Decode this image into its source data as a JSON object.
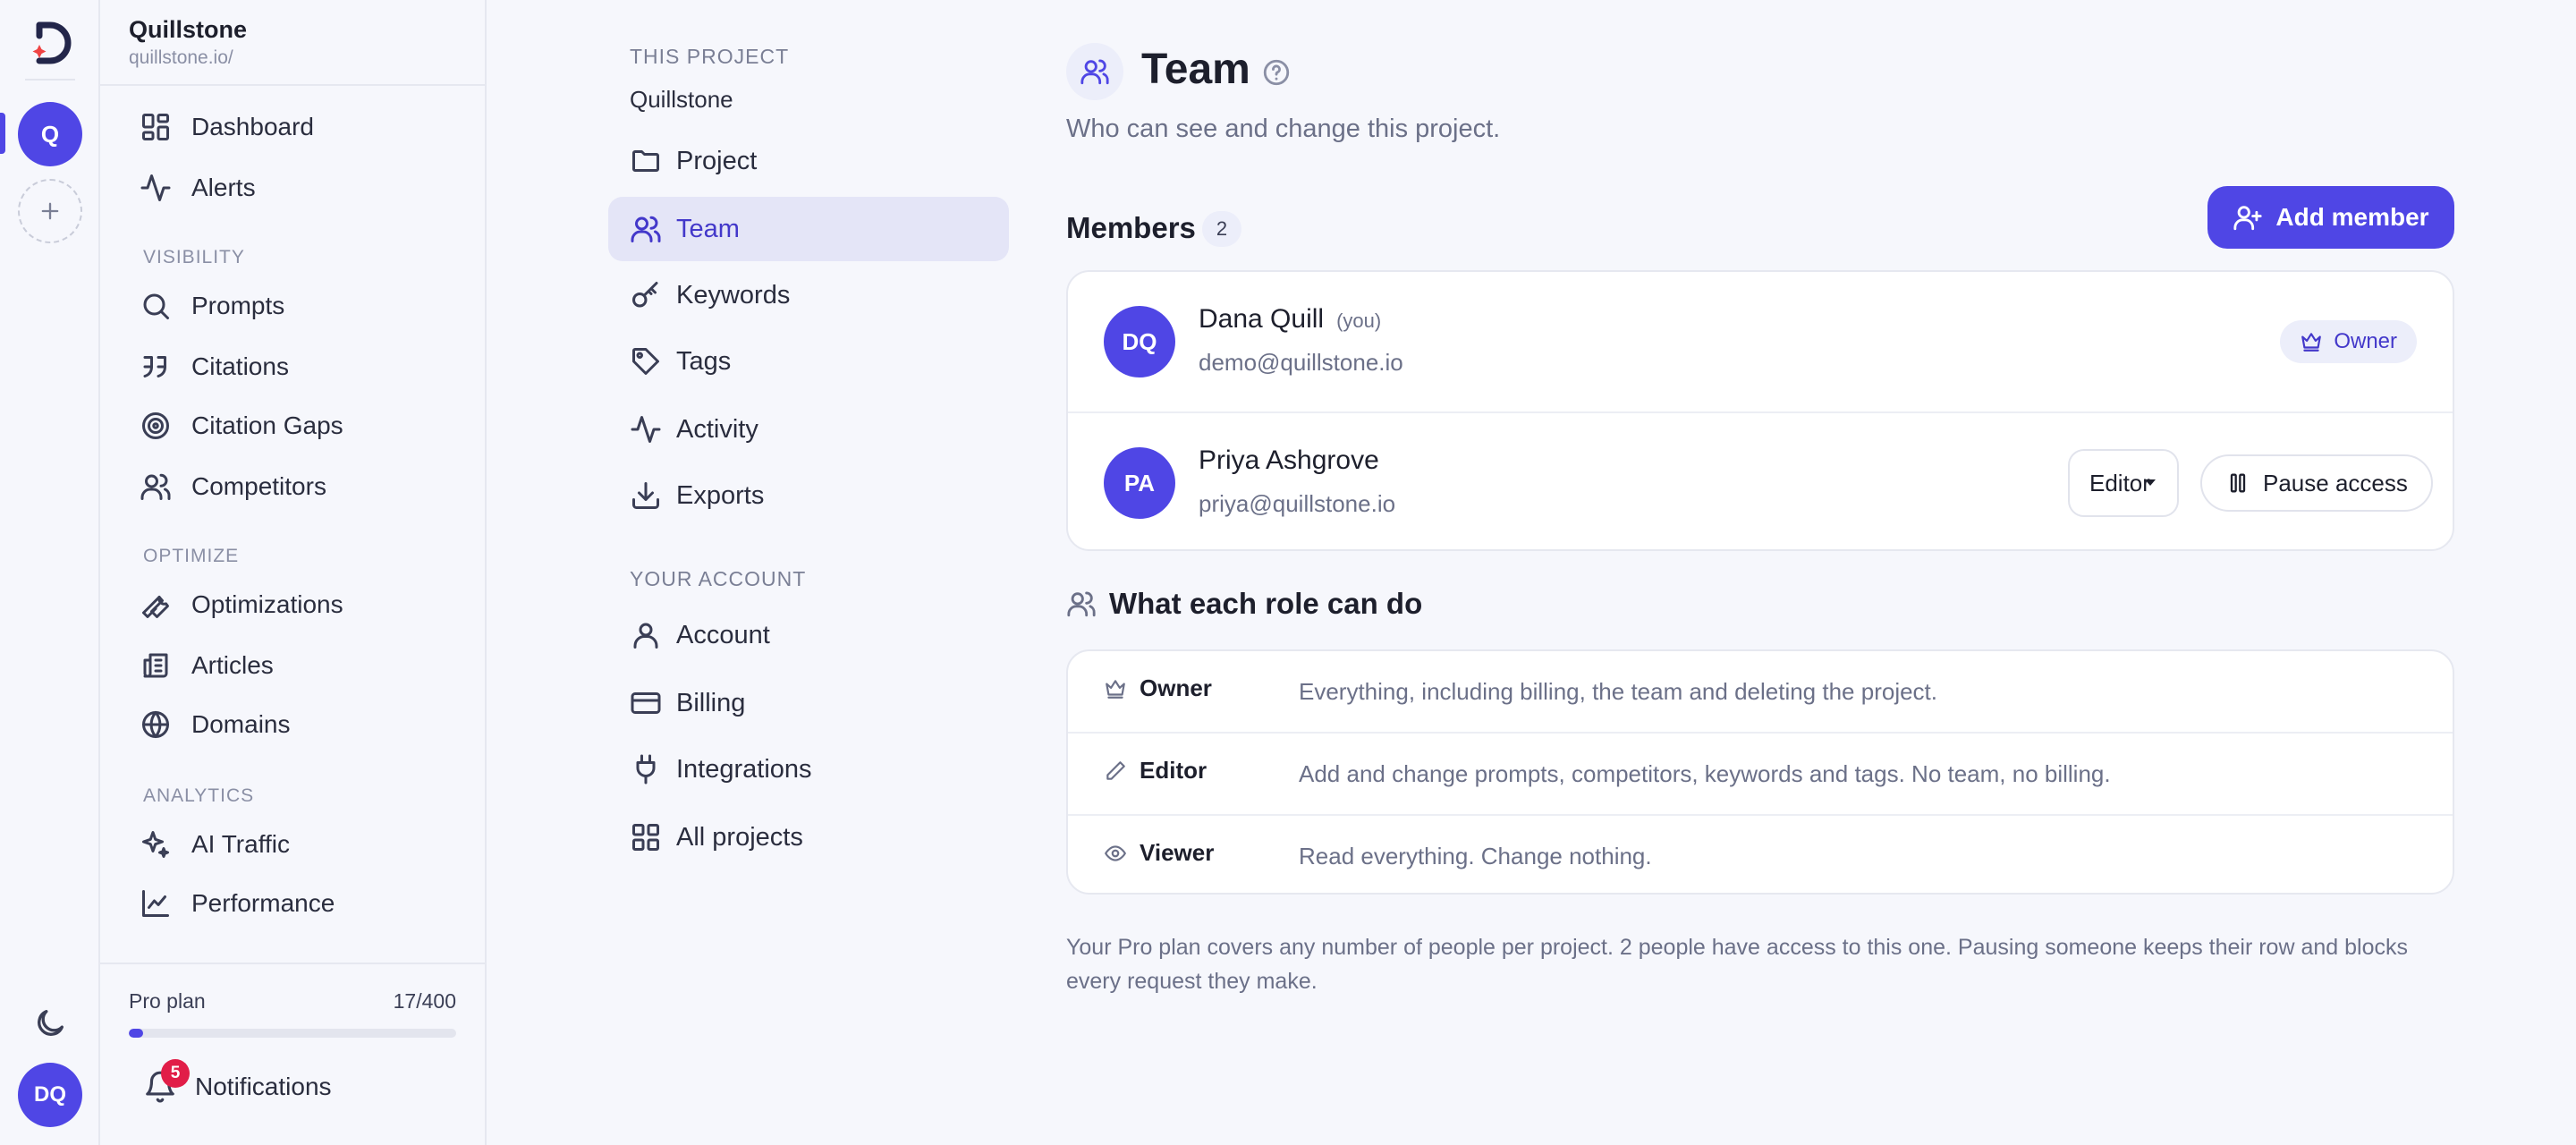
{
  "rail": {
    "project_initial": "Q",
    "user_initials": "DQ"
  },
  "sidebar": {
    "title": "Quillstone",
    "subtitle": "quillstone.io/",
    "top_items": [
      {
        "label": "Dashboard",
        "icon": "dashboard-icon"
      },
      {
        "label": "Alerts",
        "icon": "activity-icon"
      }
    ],
    "sections": [
      {
        "title": "VISIBILITY",
        "items": [
          {
            "label": "Prompts",
            "icon": "search-icon"
          },
          {
            "label": "Citations",
            "icon": "quote-icon"
          },
          {
            "label": "Citation Gaps",
            "icon": "target-icon"
          },
          {
            "label": "Competitors",
            "icon": "users-icon"
          }
        ]
      },
      {
        "title": "OPTIMIZE",
        "items": [
          {
            "label": "Optimizations",
            "icon": "wrench-icon"
          },
          {
            "label": "Articles",
            "icon": "newspaper-icon"
          },
          {
            "label": "Domains",
            "icon": "globe-icon"
          }
        ]
      },
      {
        "title": "ANALYTICS",
        "items": [
          {
            "label": "AI Traffic",
            "icon": "sparkles-icon"
          },
          {
            "label": "Performance",
            "icon": "line-chart-icon"
          }
        ]
      }
    ],
    "plan": {
      "label": "Pro plan",
      "count": "17/400",
      "used": 17,
      "total": 400
    },
    "notifications": {
      "label": "Notifications",
      "count": "5"
    }
  },
  "settings_nav": {
    "project_section": "THIS PROJECT",
    "project_name": "Quillstone",
    "project_items": [
      {
        "label": "Project",
        "icon": "folder-icon",
        "active": false
      },
      {
        "label": "Team",
        "icon": "users-icon",
        "active": true
      },
      {
        "label": "Keywords",
        "icon": "key-icon",
        "active": false
      },
      {
        "label": "Tags",
        "icon": "tag-icon",
        "active": false
      },
      {
        "label": "Activity",
        "icon": "activity-icon",
        "active": false
      },
      {
        "label": "Exports",
        "icon": "download-icon",
        "active": false
      }
    ],
    "account_section": "YOUR ACCOUNT",
    "account_items": [
      {
        "label": "Account",
        "icon": "user-icon"
      },
      {
        "label": "Billing",
        "icon": "credit-card-icon"
      },
      {
        "label": "Integrations",
        "icon": "plug-icon"
      },
      {
        "label": "All projects",
        "icon": "grid-icon"
      }
    ]
  },
  "main": {
    "title": "Team",
    "subtitle": "Who can see and change this project.",
    "members_title": "Members",
    "members_count": "2",
    "add_member_label": "Add member",
    "members": [
      {
        "initials": "DQ",
        "name": "Dana Quill",
        "you_label": "(you)",
        "email": "demo@quillstone.io",
        "role": "Owner"
      },
      {
        "initials": "PA",
        "name": "Priya Ashgrove",
        "you_label": "",
        "email": "priya@quillstone.io",
        "role": "Editor",
        "pause_label": "Pause access"
      }
    ],
    "roles_title": "What each role can do",
    "roles": [
      {
        "name": "Owner",
        "icon": "crown-icon",
        "description": "Everything, including billing, the team and deleting the project."
      },
      {
        "name": "Editor",
        "icon": "pencil-icon",
        "description": "Add and change prompts, competitors, keywords and tags. No team, no billing."
      },
      {
        "name": "Viewer",
        "icon": "eye-icon",
        "description": "Read everything. Change nothing."
      }
    ],
    "footnote": "Your Pro plan covers any number of people per project. 2 people have access to this one. Pausing someone keeps their row and blocks every request they make."
  },
  "colors": {
    "accent": "#4f46e5",
    "accent_soft": "#e4e5f7",
    "badge": "#e11d48"
  }
}
